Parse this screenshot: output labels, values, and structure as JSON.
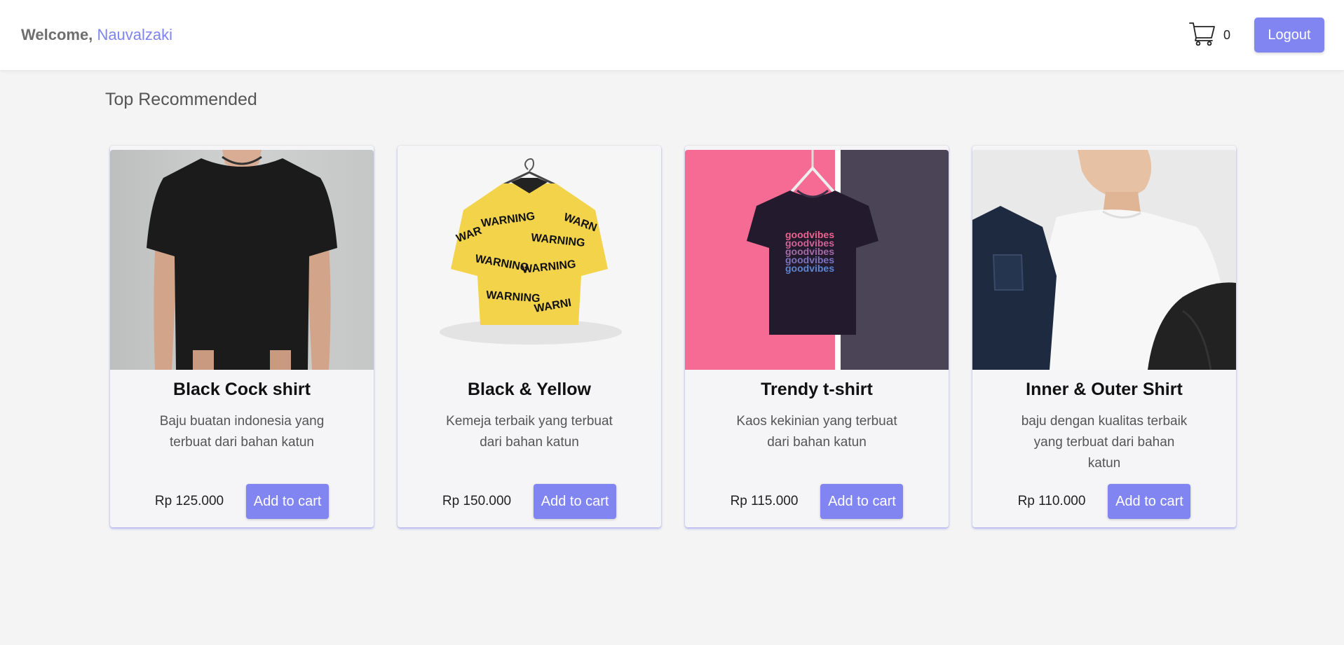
{
  "header": {
    "welcome_label": "Welcome,",
    "username": "Nauvalzaki",
    "cart_count": "0",
    "logout_label": "Logout",
    "cart_icon": "cart-icon"
  },
  "section": {
    "title": "Top Recommended"
  },
  "colors": {
    "accent": "#8185f2",
    "background": "#f4f4f4",
    "username": "#7e84f0"
  },
  "products": [
    {
      "name": "Black Cock shirt",
      "description": "Baju buatan indonesia yang terbuat dari bahan katun",
      "price": "Rp 125.000",
      "button": "Add to cart",
      "image": "black-tshirt-photo"
    },
    {
      "name": "Black & Yellow",
      "description": "Kemeja terbaik yang terbuat dari bahan katun",
      "price": "Rp 150.000",
      "button": "Add to cart",
      "image": "yellow-warning-shirt-photo"
    },
    {
      "name": "Trendy t-shirt",
      "description": "Kaos kekinian yang terbuat dari bahan katun",
      "price": "Rp 115.000",
      "button": "Add to cart",
      "image": "goodvibes-tshirt-photo"
    },
    {
      "name": "Inner & Outer Shirt",
      "description": "baju dengan kualitas terbaik yang terbuat dari bahan katun",
      "price": "Rp 110.000",
      "button": "Add to cart",
      "image": "white-shirt-jacket-photo"
    }
  ]
}
